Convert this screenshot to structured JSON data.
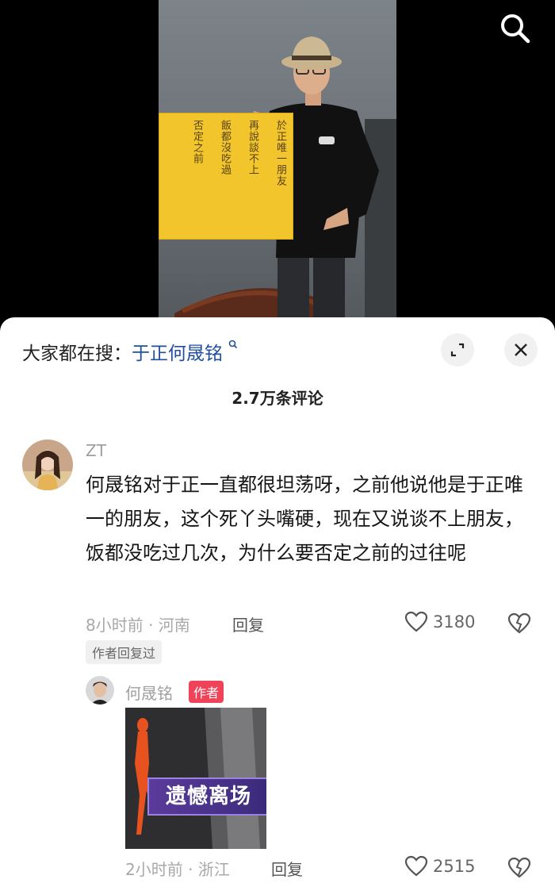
{
  "video": {
    "search_icon": "search-icon",
    "calligraphy": [
      "於正唯一朋友",
      "再說談不上",
      "飯都沒吃過",
      "否定之前"
    ]
  },
  "panel": {
    "search_prefix": "大家都在搜：",
    "search_keyword": "于正何晟铭",
    "search_mini_icon": "ꟴ",
    "expand_icon": "expand-icon",
    "close_icon": "close-icon",
    "comment_count": "2.7万条评论"
  },
  "comment": {
    "username": "ZT",
    "text": "何晟铭对于正一直都很坦荡呀，之前他说他是于正唯一的朋友，这个死丫头嘴硬，现在又说谈不上朋友，饭都没吃过几次，为什么要否定之前的过往呢",
    "meta": "8小时前 · 河南",
    "reply_label": "回复",
    "likes": "3180",
    "author_replied": "作者回复过"
  },
  "reply": {
    "username": "何晟铭",
    "author_tag": "作者",
    "sticker_caption": "遗憾离场",
    "meta": "2小时前 · 浙江",
    "reply_label": "回复",
    "likes": "2515"
  },
  "colors": {
    "keyword": "#1f4f9e",
    "author_tag": "#f0435a",
    "board": "#f3c52d"
  }
}
